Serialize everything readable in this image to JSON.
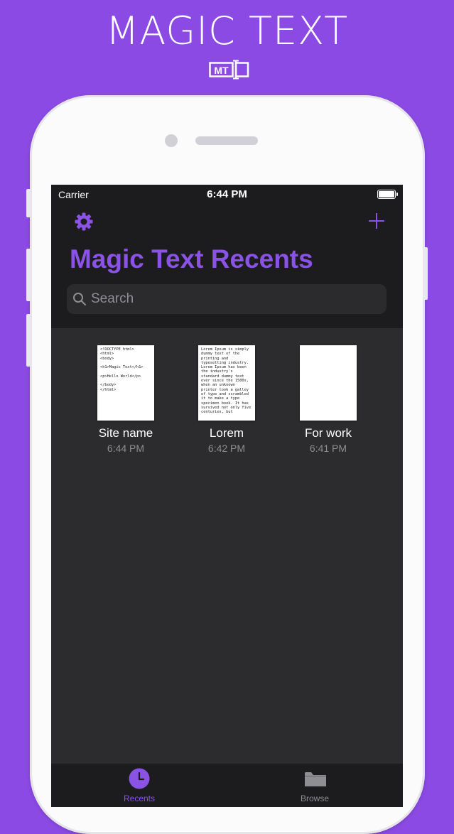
{
  "promo": {
    "title": "MAGIC TEXT",
    "logo_text": "MT"
  },
  "status_bar": {
    "carrier": "Carrier",
    "time": "6:44 PM"
  },
  "header": {
    "title": "Magic Text Recents"
  },
  "search": {
    "placeholder": "Search"
  },
  "documents": [
    {
      "name": "Site name",
      "time": "6:44 PM",
      "preview": "<!DOCTYPE html>\n<html>\n<body>\n\n<h1>Magic Text</h1>\n\n<p>Hello World</p>\n\n</body>\n</html>"
    },
    {
      "name": "Lorem",
      "time": "6:42 PM",
      "preview": "Lorem Ipsum is simply dummy text of the printing and typesetting industry. Lorem Ipsum has been the industry's standard dummy text ever since the 1500s, when an unknown printer took a galley of type and scrambled it to make a type specimen book. It has survived not only five centuries, but"
    },
    {
      "name": "For work",
      "time": "6:41 PM",
      "preview": ""
    }
  ],
  "tabs": [
    {
      "label": "Recents",
      "icon": "clock-icon",
      "active": true
    },
    {
      "label": "Browse",
      "icon": "folder-icon",
      "active": false
    }
  ],
  "colors": {
    "accent": "#8b52e6",
    "background": "#8c4ae4",
    "screen": "#2c2c2e",
    "bars": "#1c1c1e",
    "inactive": "#8e8e93"
  }
}
